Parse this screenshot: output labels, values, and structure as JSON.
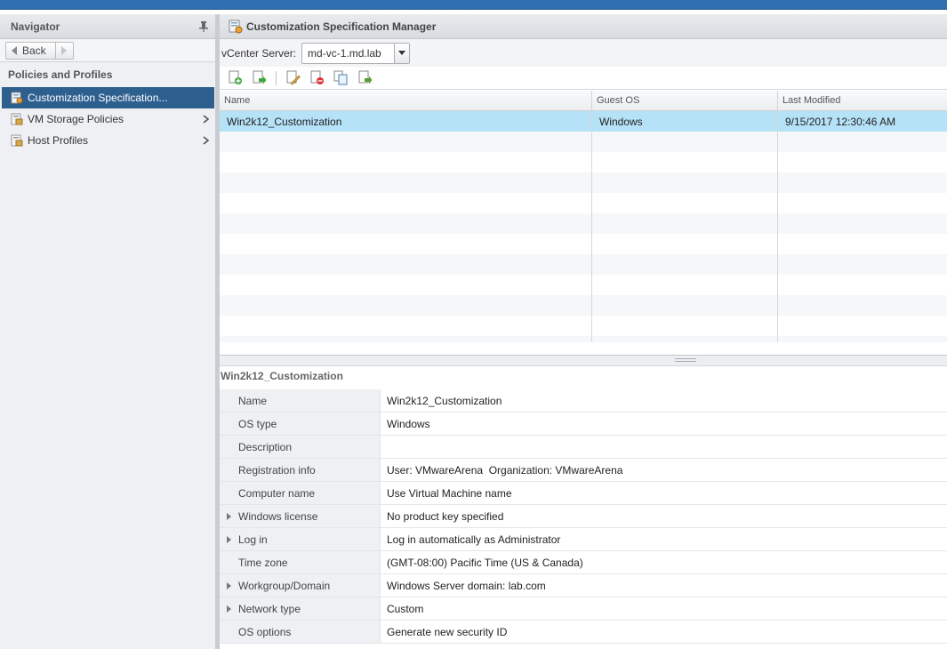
{
  "navigator": {
    "title": "Navigator",
    "back_label": "Back",
    "section_title": "Policies and Profiles",
    "items": [
      {
        "label": "Customization Specification...",
        "selected": true
      },
      {
        "label": "VM Storage Policies"
      },
      {
        "label": "Host Profiles"
      }
    ]
  },
  "main": {
    "title": "Customization Specification Manager",
    "vcenter_label": "vCenter Server:",
    "vcenter_value": "md-vc-1.md.lab",
    "grid": {
      "columns": [
        "Name",
        "Guest OS",
        "Last Modified"
      ],
      "rows": [
        {
          "name": "Win2k12_Customization",
          "guest_os": "Windows",
          "last_modified": "9/15/2017 12:30:46 AM"
        }
      ]
    },
    "detail": {
      "title": "Win2k12_Customization",
      "properties": [
        {
          "key": "Name",
          "value": "Win2k12_Customization",
          "expandable": false
        },
        {
          "key": "OS type",
          "value": "Windows",
          "expandable": false
        },
        {
          "key": "Description",
          "value": "",
          "expandable": false
        },
        {
          "key": "Registration info",
          "value": "User: VMwareArena  Organization: VMwareArena",
          "expandable": false
        },
        {
          "key": "Computer name",
          "value": "Use Virtual Machine name",
          "expandable": false
        },
        {
          "key": "Windows license",
          "value": "No product key specified",
          "expandable": true
        },
        {
          "key": "Log in",
          "value": "Log in automatically as Administrator",
          "expandable": true
        },
        {
          "key": "Time zone",
          "value": "(GMT-08:00) Pacific Time (US & Canada)",
          "expandable": false
        },
        {
          "key": "Workgroup/Domain",
          "value": "Windows Server domain: lab.com",
          "expandable": true
        },
        {
          "key": "Network type",
          "value": "Custom",
          "expandable": true
        },
        {
          "key": "OS options",
          "value": "Generate new security ID",
          "expandable": false
        }
      ]
    }
  },
  "colors": {
    "selection_nav": "#2d5f8f",
    "selection_row": "#b6e2f8",
    "topbar": "#2f6fb0"
  }
}
